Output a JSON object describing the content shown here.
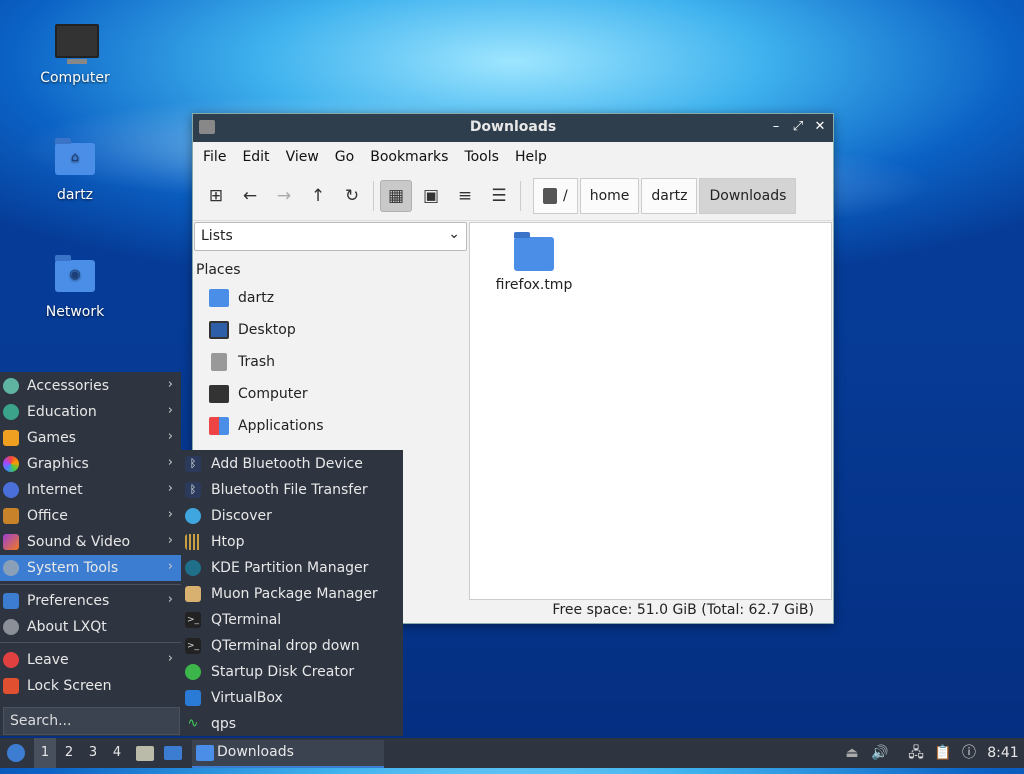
{
  "desktop": {
    "icons": [
      {
        "label": "Computer"
      },
      {
        "label": "dartz"
      },
      {
        "label": "Network"
      }
    ]
  },
  "window": {
    "title": "Downloads",
    "controls": {
      "minimize": "–",
      "maximize": "⤢",
      "close": "✕"
    },
    "menu": [
      "File",
      "Edit",
      "View",
      "Go",
      "Bookmarks",
      "Tools",
      "Help"
    ],
    "toolbar": {
      "new_tab": "⊞",
      "back": "←",
      "forward": "→",
      "up": "↑",
      "reload": "↻",
      "icon_view": "▦",
      "thumb_view": "▣",
      "compact_view": "≡",
      "detail_view": "☰"
    },
    "breadcrumb": [
      "/",
      "home",
      "dartz",
      "Downloads"
    ],
    "side_pane_mode": "Lists",
    "places_header": "Places",
    "places": [
      "dartz",
      "Desktop",
      "Trash",
      "Computer",
      "Applications"
    ],
    "files": [
      {
        "name": "firefox.tmp"
      }
    ],
    "status": "Free space: 51.0 GiB (Total: 62.7 GiB)"
  },
  "start_menu": {
    "categories": [
      "Accessories",
      "Education",
      "Games",
      "Graphics",
      "Internet",
      "Office",
      "Sound & Video",
      "System Tools"
    ],
    "selected": "System Tools",
    "extra": [
      "Preferences",
      "About LXQt"
    ],
    "session": [
      "Leave",
      "Lock Screen"
    ],
    "search_placeholder": "Search...",
    "submenu": [
      "Add Bluetooth Device",
      "Bluetooth File Transfer",
      "Discover",
      "Htop",
      "KDE Partition Manager",
      "Muon Package Manager",
      "QTerminal",
      "QTerminal drop down",
      "Startup Disk Creator",
      "VirtualBox",
      "qps"
    ]
  },
  "taskbar": {
    "desktops": [
      "1",
      "2",
      "3",
      "4"
    ],
    "active_desktop": "1",
    "task": "Downloads",
    "clock": "8:41"
  },
  "colors": {
    "accent": "#3d7dd1",
    "panel": "#2e3440",
    "folder": "#4a8ee8"
  }
}
